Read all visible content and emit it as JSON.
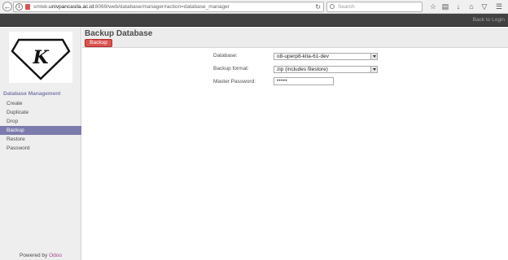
{
  "browser": {
    "url_prefix": "smtek.",
    "url_host": "univpancasila.ac.id",
    "url_rest": ":8069/web/database/manager#action=database_manager",
    "search_placeholder": "Search"
  },
  "topbar": {
    "back_link": "Back to Login"
  },
  "sidebar": {
    "logo_letter": "K",
    "section_title": "Database Management",
    "items": [
      {
        "label": "Create",
        "active": false
      },
      {
        "label": "Duplicate",
        "active": false
      },
      {
        "label": "Drop",
        "active": false
      },
      {
        "label": "Backup",
        "active": true
      },
      {
        "label": "Restore",
        "active": false
      },
      {
        "label": "Password",
        "active": false
      }
    ],
    "powered_prefix": "Powered by ",
    "powered_brand": "Odoo"
  },
  "main": {
    "title": "Backup Database",
    "backup_button": "Backup",
    "form": {
      "database_label": "Database:",
      "database_value": "o8-uperp8-kita-61-dev",
      "format_label": "Backup format:",
      "format_value": "zip (includes filestore)",
      "password_label": "Master Password:",
      "password_value": "•••••"
    }
  }
}
